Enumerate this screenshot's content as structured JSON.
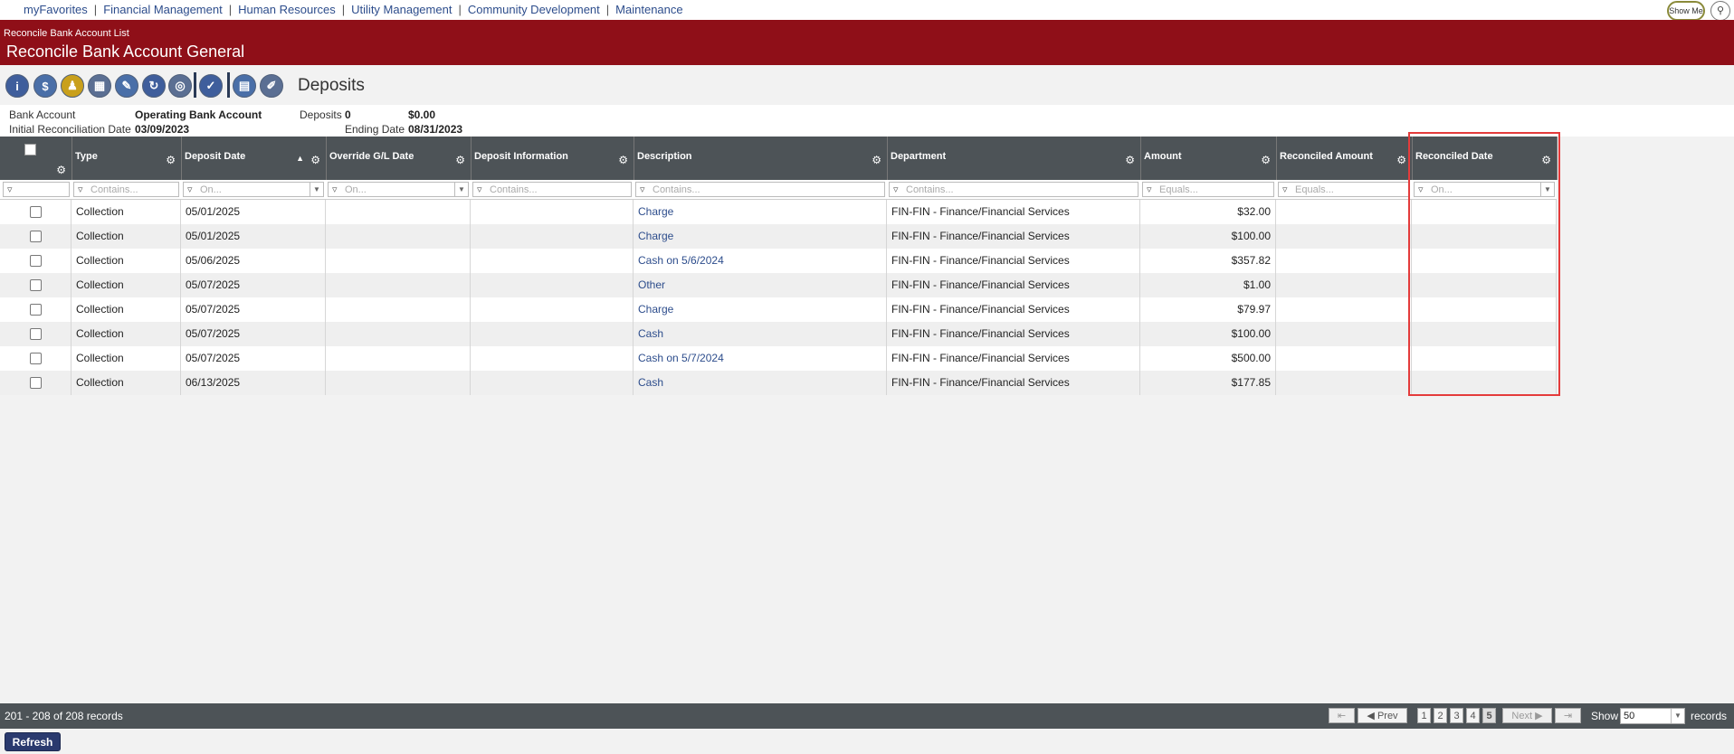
{
  "topnav": {
    "links": [
      "myFavorites",
      "Financial Management",
      "Human Resources",
      "Utility Management",
      "Community Development",
      "Maintenance"
    ],
    "show_me": "Show Me",
    "search_icon": "magnifier-icon"
  },
  "banner": {
    "breadcrumb": "Reconcile Bank Account List",
    "title": "Reconcile Bank Account General"
  },
  "toolbar": {
    "section_title": "Deposits",
    "icons": [
      "info-icon",
      "transfer-icon",
      "people-icon",
      "bank-icon",
      "checkbook-icon",
      "adjust-icon",
      "coins-icon",
      "post-icon",
      "report-icon",
      "edit-icon"
    ],
    "accent": "#2a3a6e"
  },
  "info": {
    "bank_account_label": "Bank Account",
    "bank_account_value": "Operating Bank Account",
    "deposits_label": "Deposits",
    "deposits_count": "0",
    "deposits_amount": "$0.00",
    "initial_date_label": "Initial Reconciliation Date",
    "initial_date_value": "03/09/2023",
    "ending_date_label": "Ending Date",
    "ending_date_value": "08/31/2023"
  },
  "grid": {
    "columns": [
      {
        "key": "type",
        "label": "Type",
        "filter": "Contains..."
      },
      {
        "key": "deposit_date",
        "label": "Deposit Date",
        "filter": "On..."
      },
      {
        "key": "override_gl_date",
        "label": "Override G/L Date",
        "filter": "On..."
      },
      {
        "key": "deposit_info",
        "label": "Deposit Information",
        "filter": "Contains..."
      },
      {
        "key": "description",
        "label": "Description",
        "filter": "Contains..."
      },
      {
        "key": "department",
        "label": "Department",
        "filter": "Contains..."
      },
      {
        "key": "amount",
        "label": "Amount",
        "filter": "Equals..."
      },
      {
        "key": "reconciled_amount",
        "label": "Reconciled Amount",
        "filter": "Equals..."
      },
      {
        "key": "reconciled_date",
        "label": "Reconciled Date",
        "filter": "On..."
      }
    ],
    "rows": [
      {
        "type": "Collection",
        "deposit_date": "05/01/2025",
        "description": "Charge",
        "department": "FIN-FIN - Finance/Financial Services",
        "amount": "$32.00"
      },
      {
        "type": "Collection",
        "deposit_date": "05/01/2025",
        "description": "Charge",
        "department": "FIN-FIN - Finance/Financial Services",
        "amount": "$100.00"
      },
      {
        "type": "Collection",
        "deposit_date": "05/06/2025",
        "description": "Cash on 5/6/2024",
        "department": "FIN-FIN - Finance/Financial Services",
        "amount": "$357.82"
      },
      {
        "type": "Collection",
        "deposit_date": "05/07/2025",
        "description": "Other",
        "department": "FIN-FIN - Finance/Financial Services",
        "amount": "$1.00"
      },
      {
        "type": "Collection",
        "deposit_date": "05/07/2025",
        "description": "Charge",
        "department": "FIN-FIN - Finance/Financial Services",
        "amount": "$79.97"
      },
      {
        "type": "Collection",
        "deposit_date": "05/07/2025",
        "description": "Cash",
        "department": "FIN-FIN - Finance/Financial Services",
        "amount": "$100.00"
      },
      {
        "type": "Collection",
        "deposit_date": "05/07/2025",
        "description": "Cash on 5/7/2024",
        "department": "FIN-FIN - Finance/Financial Services",
        "amount": "$500.00"
      },
      {
        "type": "Collection",
        "deposit_date": "06/13/2025",
        "description": "Cash",
        "department": "FIN-FIN - Finance/Financial Services",
        "amount": "$177.85"
      }
    ]
  },
  "pager": {
    "record_count": "201 - 208 of 208 records",
    "prev_label": "Prev",
    "next_label": "Next",
    "pages": [
      "1",
      "2",
      "3",
      "4",
      "5"
    ],
    "show_label": "Show",
    "page_size": "50",
    "records_label": "records"
  },
  "refresh_label": "Refresh"
}
